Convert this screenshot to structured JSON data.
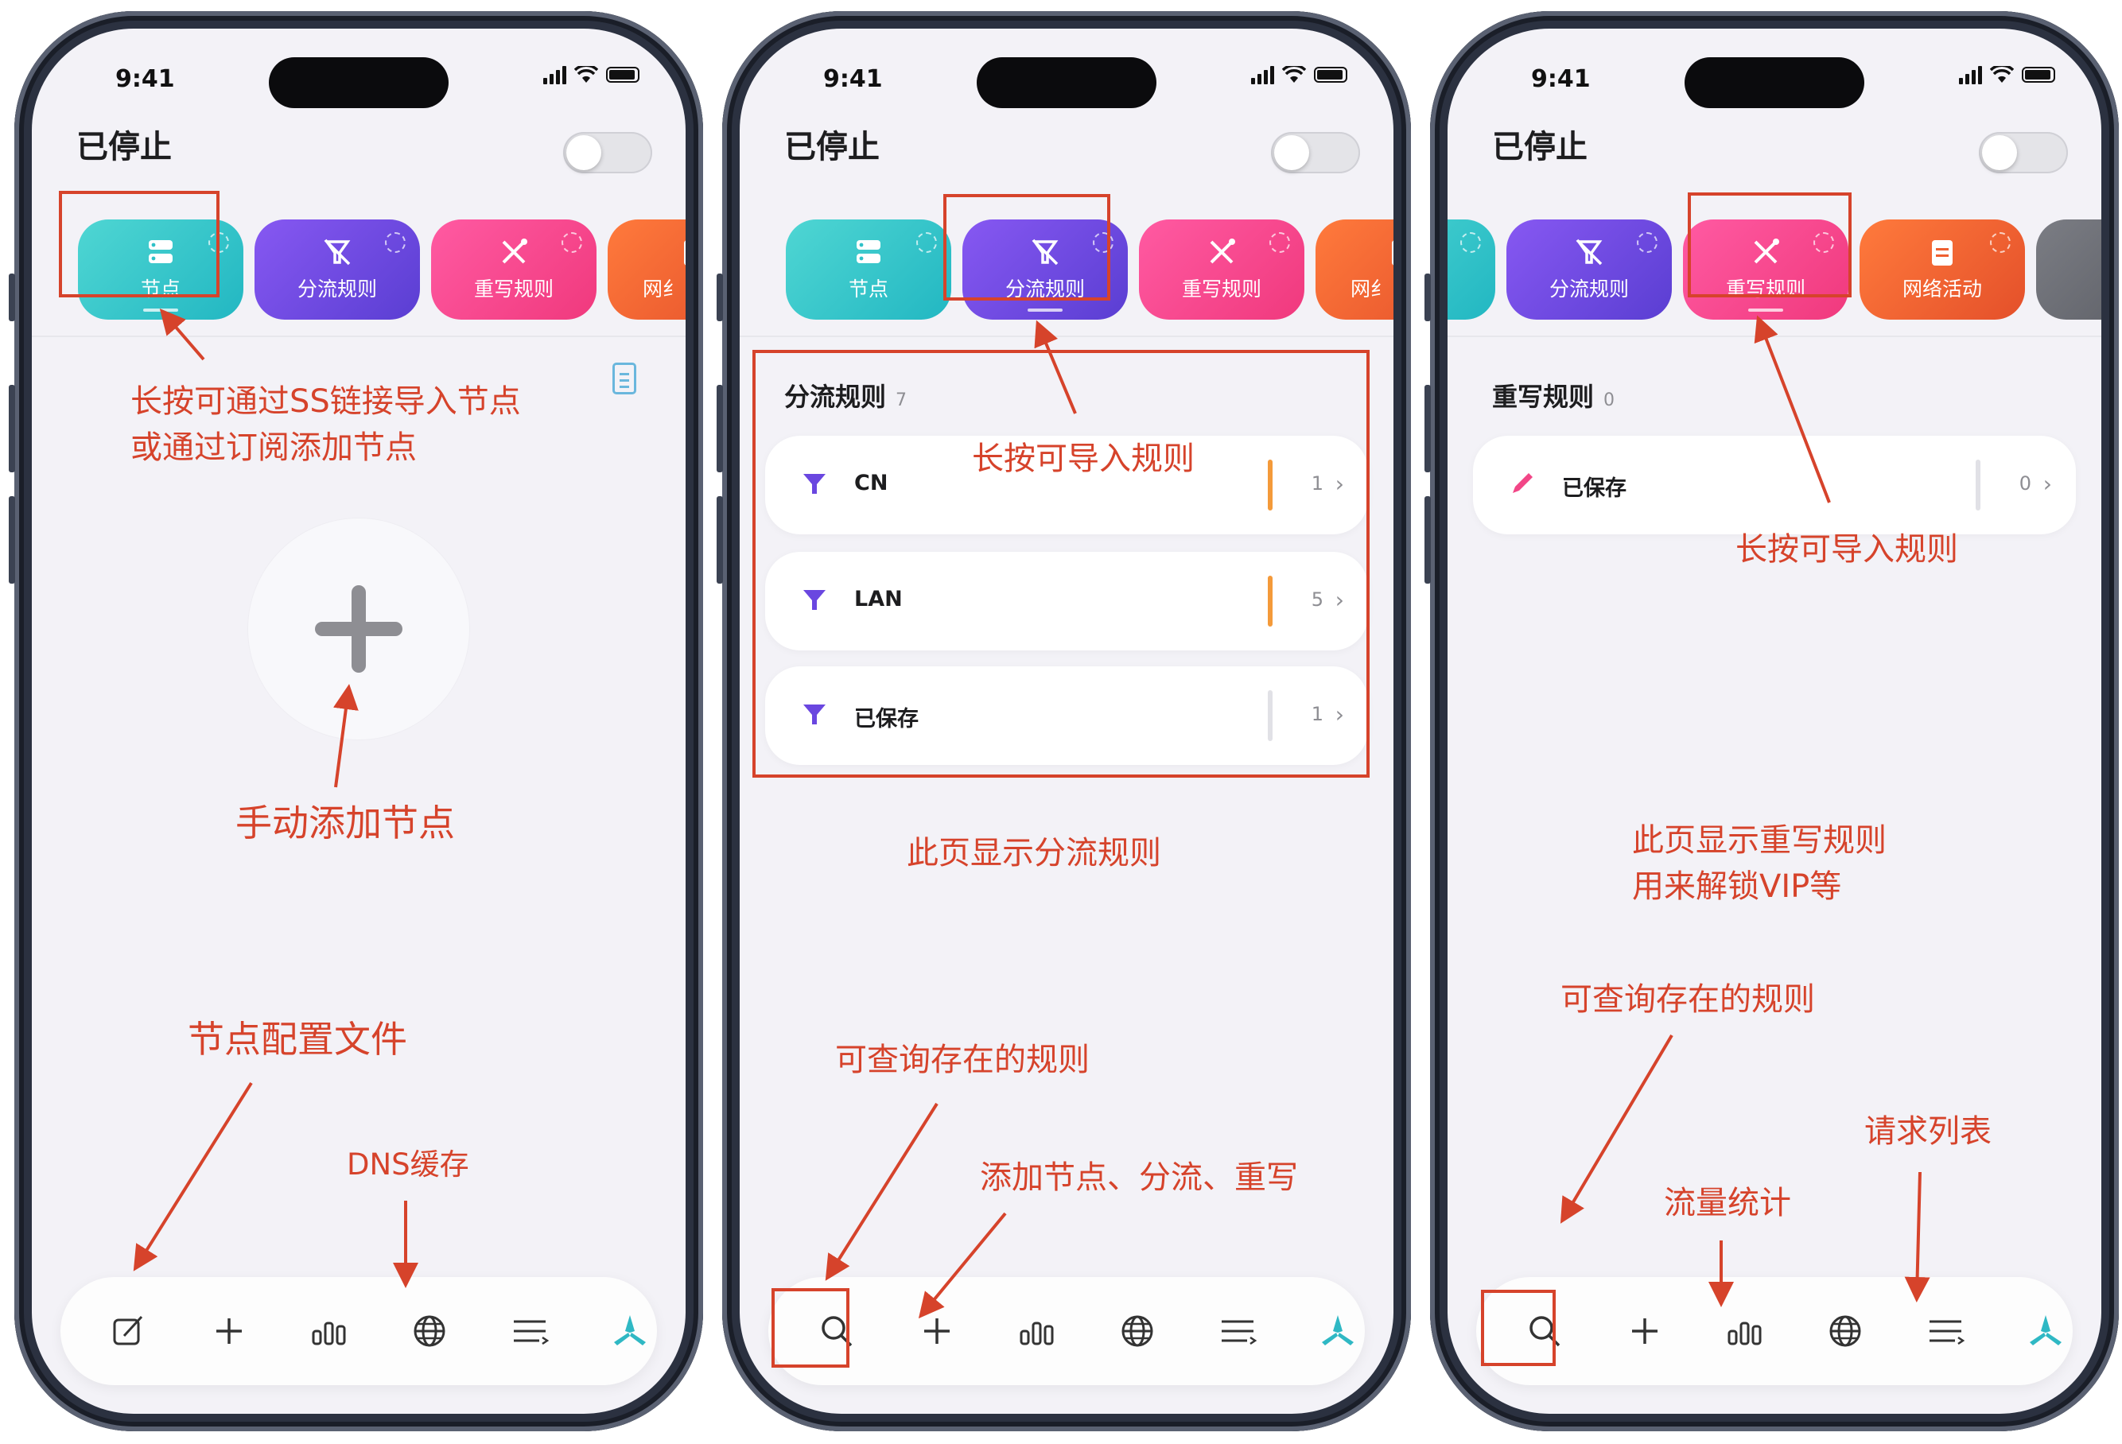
{
  "status_bar": {
    "time": "9:41"
  },
  "app": {
    "status_title": "已停止"
  },
  "tabs": {
    "node": "节点",
    "rule": "分流规则",
    "rewrite": "重写规则",
    "net_activity": "网络活动",
    "net_partial": "网纟"
  },
  "screen2": {
    "section_title": "分流规则",
    "section_count": "7",
    "rules": [
      {
        "name": "CN",
        "count": "1",
        "bar_color": "#f49a3a"
      },
      {
        "name": "LAN",
        "count": "5",
        "bar_color": "#f49a3a"
      },
      {
        "name": "已保存",
        "count": "1",
        "bar_color": "#e1e1e6"
      }
    ]
  },
  "screen3": {
    "section_title": "重写规则",
    "section_count": "0",
    "rules": [
      {
        "name": "已保存",
        "count": "0",
        "bar_color": "#e1e1e6"
      }
    ]
  },
  "bottom_bar_icons": [
    "edit-icon",
    "plus-icon",
    "stats-icon",
    "globe-icon",
    "list-icon",
    "logo-icon"
  ],
  "annotations": {
    "p1_import_line1": "长按可通过SS链接导入节点",
    "p1_import_line2": "或通过订阅添加节点",
    "p1_manual_add": "手动添加节点",
    "p1_config_file": "节点配置文件",
    "p1_dns_cache": "DNS缓存",
    "p2_long_press": "长按可导入规则",
    "p2_page_desc": "此页显示分流规则",
    "p2_query": "可查询存在的规则",
    "p2_add": "添加节点、分流、重写",
    "p3_long_press": "长按可导入规则",
    "p3_page_desc_line1": "此页显示重写规则",
    "p3_page_desc_line2": "用来解锁VIP等",
    "p3_query": "可查询存在的规则",
    "p3_traffic": "流量统计",
    "p3_requests": "请求列表"
  },
  "colors": {
    "annotation_red": "#d6432b",
    "node_teal": "#2fc1c8",
    "rule_purple": "#6a47e0",
    "rewrite_pink": "#f24687",
    "net_orange": "#ef5f30"
  }
}
